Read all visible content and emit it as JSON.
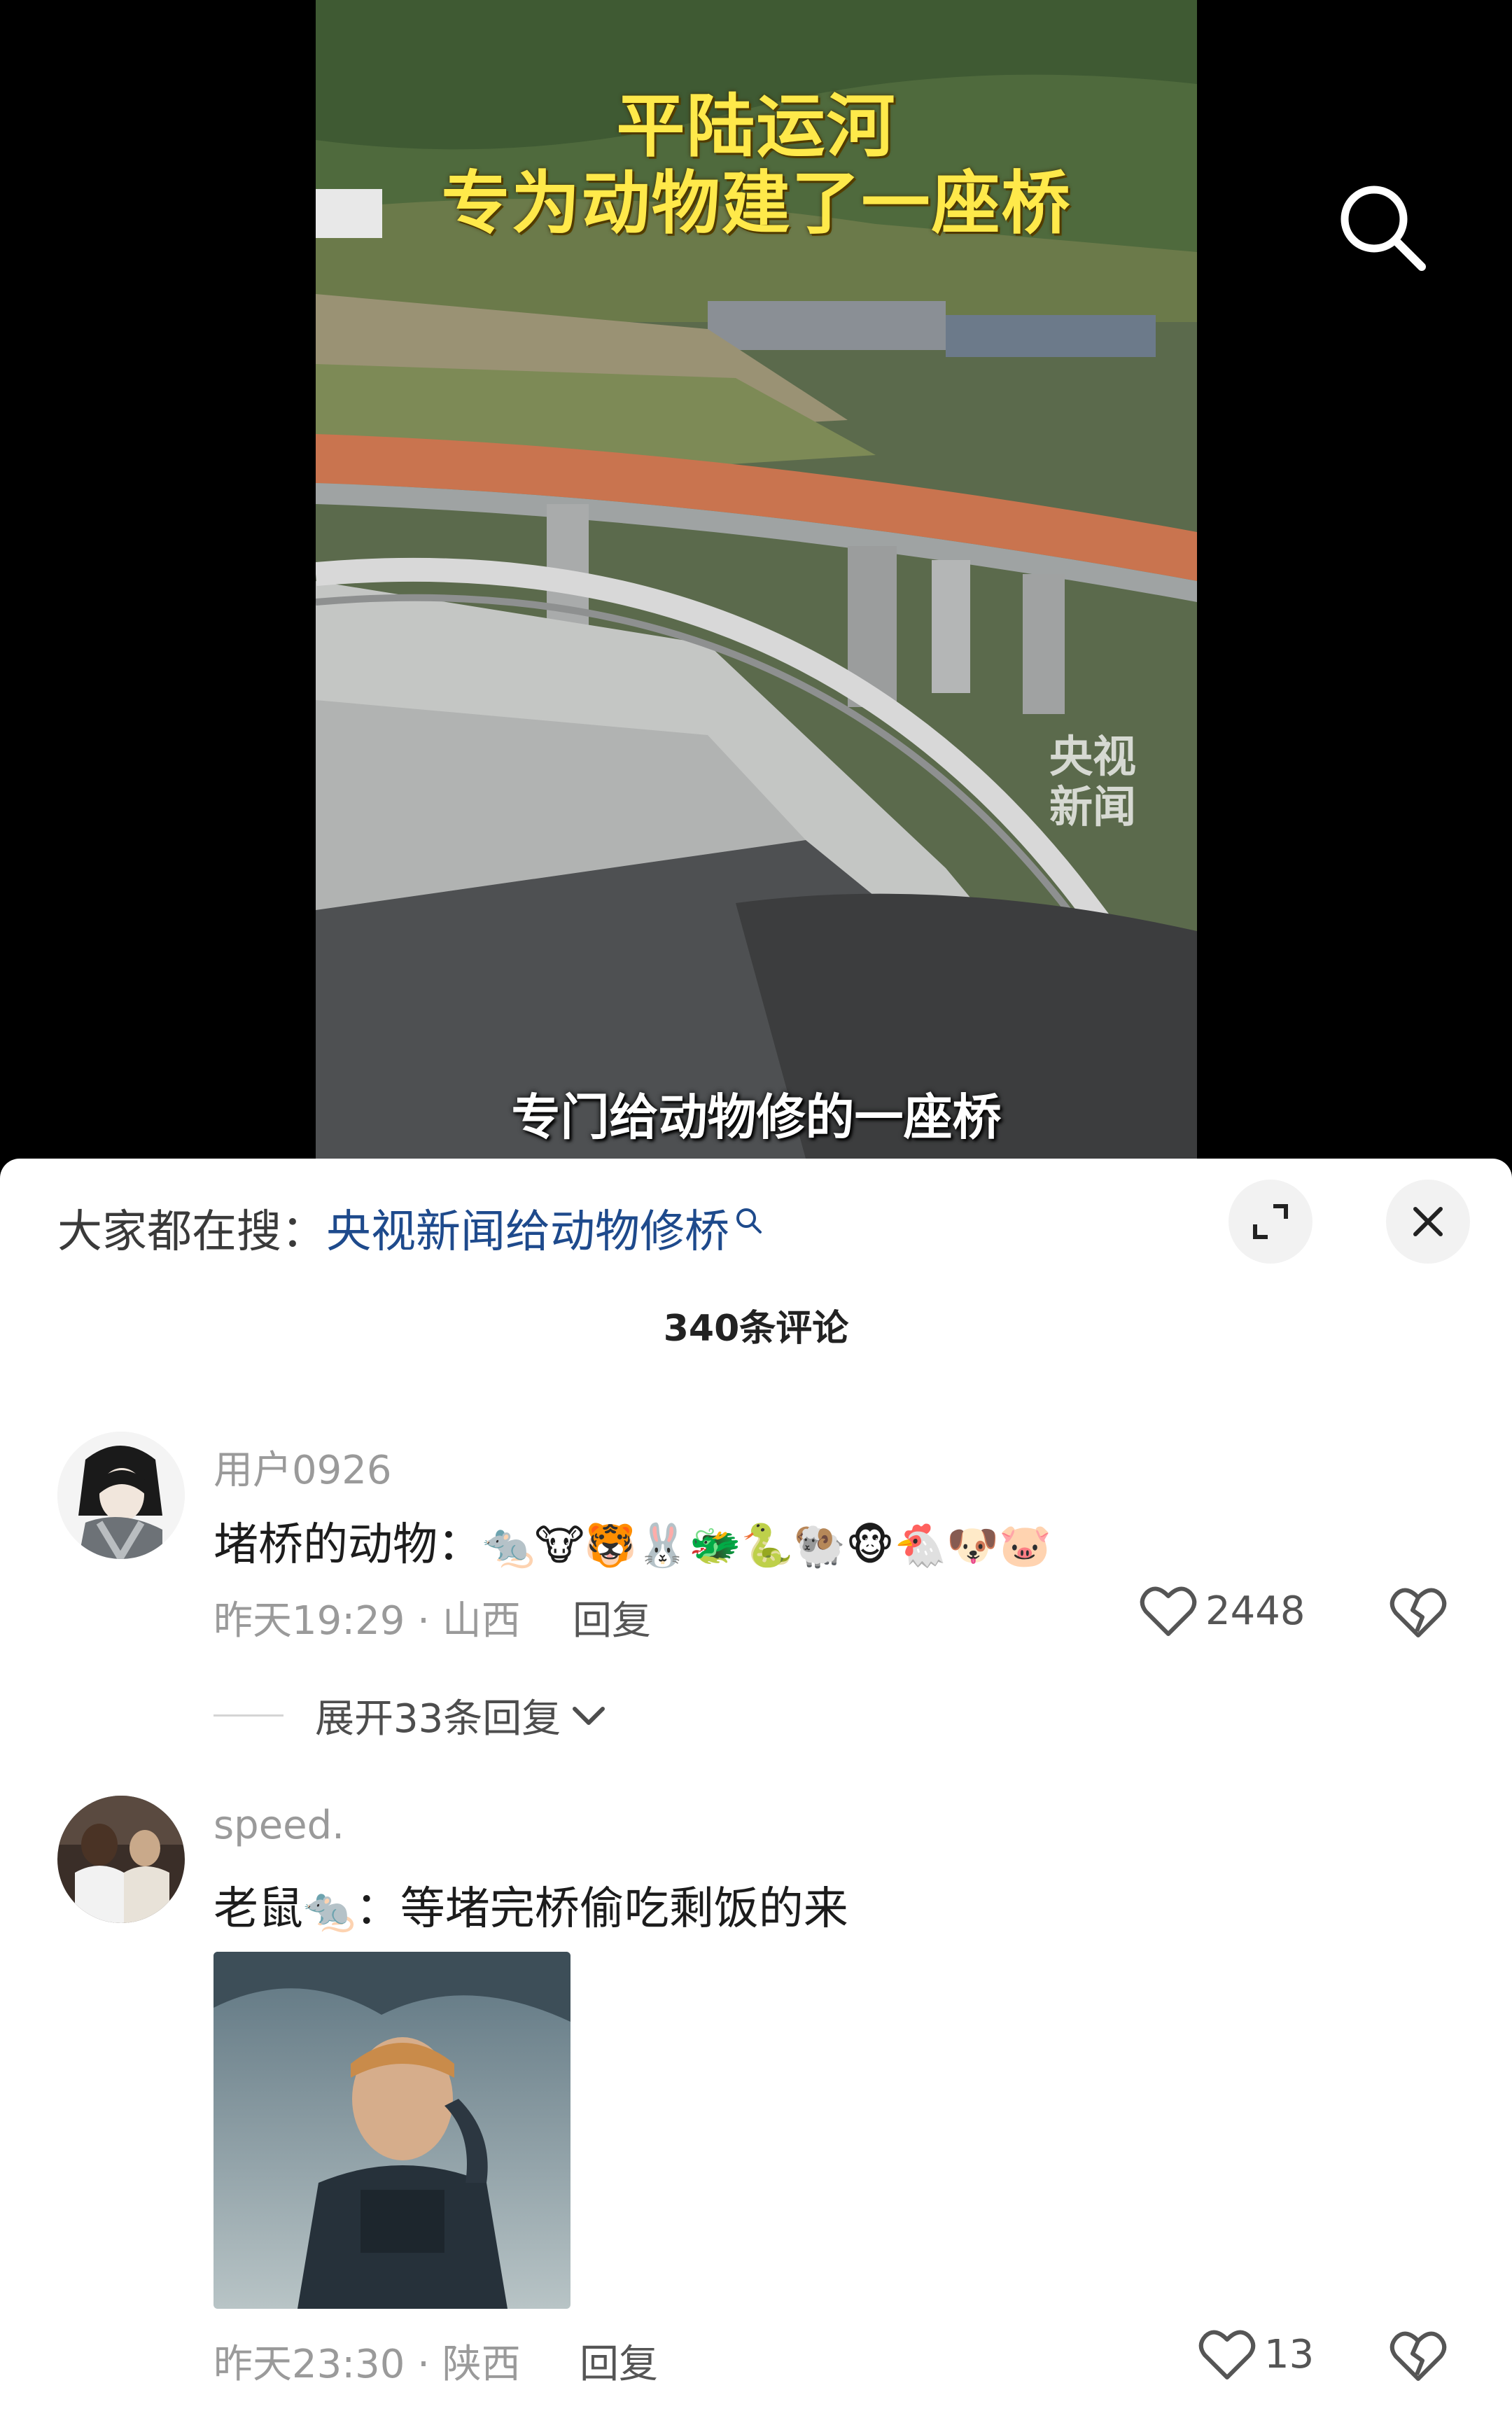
{
  "video": {
    "title_line1": "平陆运河",
    "title_line2": "专为动物建了一座桥",
    "watermark_line1": "央视",
    "watermark_line2": "新闻",
    "subtitle": "专门给动物修的一座桥"
  },
  "hot_search": {
    "prefix": "大家都在搜：",
    "link": "央视新闻给动物修桥"
  },
  "comments_header": {
    "count_label": "340条评论"
  },
  "comments": [
    {
      "username": "用户0926",
      "text": "堵桥的动物：",
      "emojis": "🐀🐮🐯🐰🐲🐍🐏🐵🐔🐶🐷",
      "time": "昨天19:29 · 山西",
      "reply_label": "回复",
      "likes": "2448",
      "expand_label": "展开33条回复"
    },
    {
      "username": "speed.",
      "text_prefix": "老鼠",
      "text_emoji": "🐀",
      "text_suffix": "：等堵完桥偷吃剩饭的来",
      "time": "昨天23:30 · 陕西",
      "reply_label": "回复",
      "likes": "13"
    }
  ],
  "icons": {
    "search": "search-icon",
    "expand": "expand-icon",
    "close": "close-icon",
    "like": "heart-icon",
    "dislike": "broken-heart-icon",
    "chevron": "chevron-down-icon"
  },
  "colors": {
    "link": "#1e4a8c",
    "title_yellow": "#ffe94a"
  }
}
